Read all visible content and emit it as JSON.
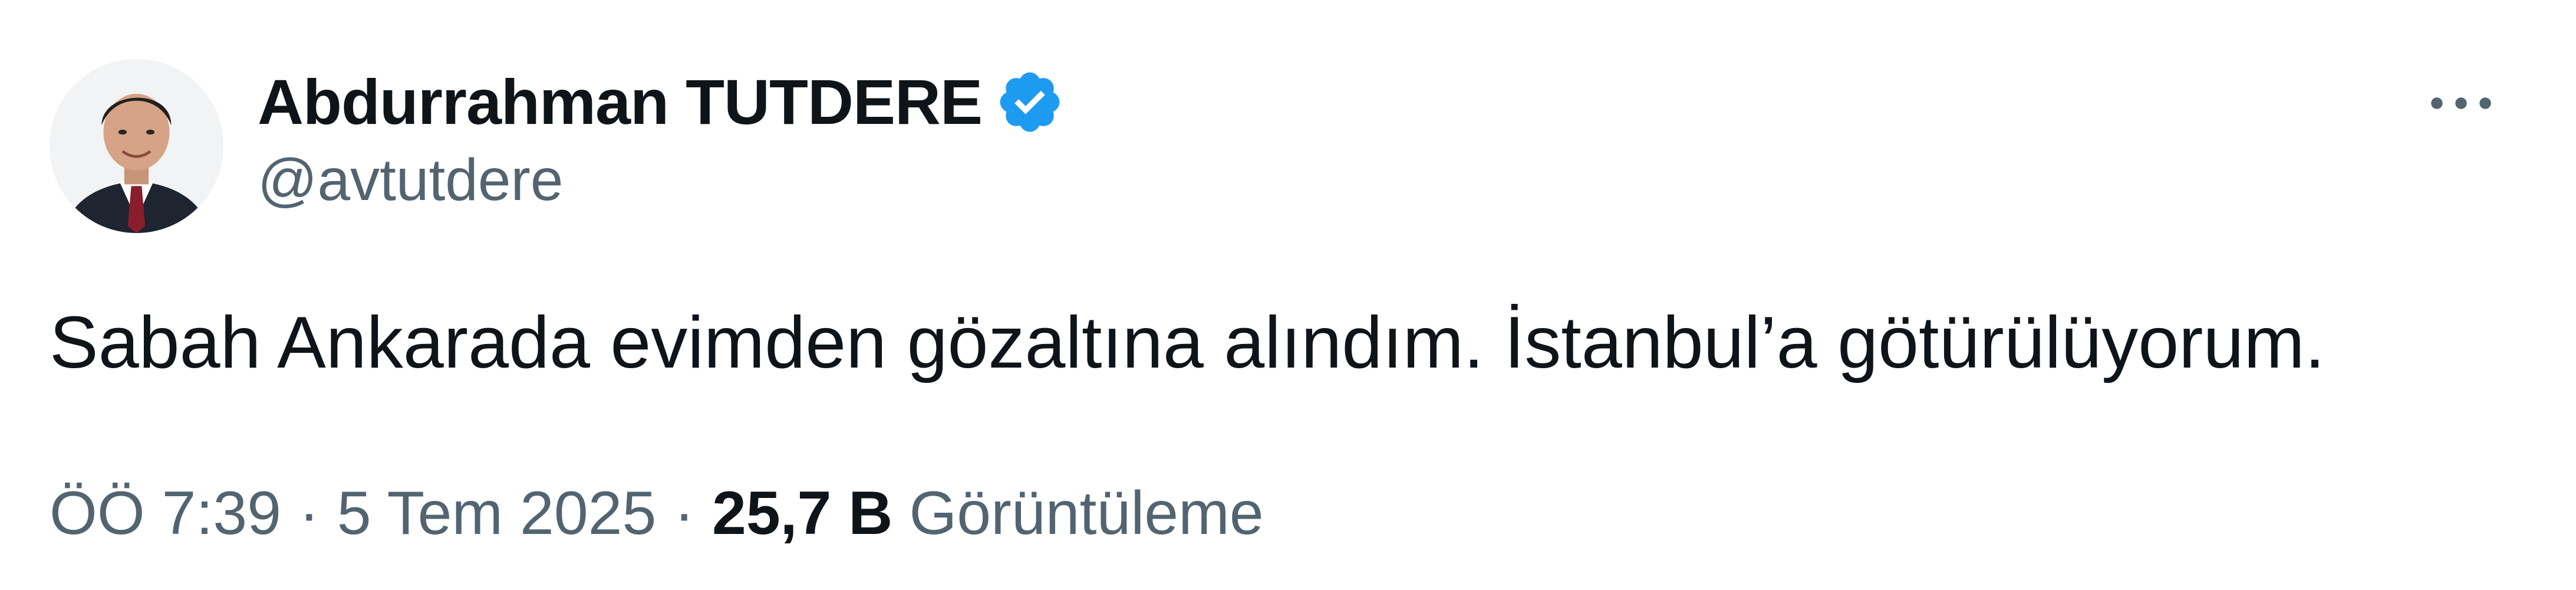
{
  "author": {
    "display_name": "Abdurrahman TUTDERE",
    "handle": "@avtutdere",
    "verified": true,
    "verified_icon": "verified-badge-icon",
    "verified_color": "#1d9bf0"
  },
  "tweet": {
    "text": "Sabah Ankarada evimden gözaltına alındım. İstanbul’a götürülüyorum."
  },
  "meta": {
    "time": "ÖÖ 7:39",
    "separator": "·",
    "date": "5 Tem 2025",
    "views_count": "25,7 B",
    "views_label": "Görüntüleme"
  },
  "menu": {
    "icon": "more-horizontal-icon"
  },
  "colors": {
    "primary_text": "#0f1419",
    "secondary_text": "#536471",
    "accent": "#1d9bf0",
    "background": "#ffffff"
  }
}
